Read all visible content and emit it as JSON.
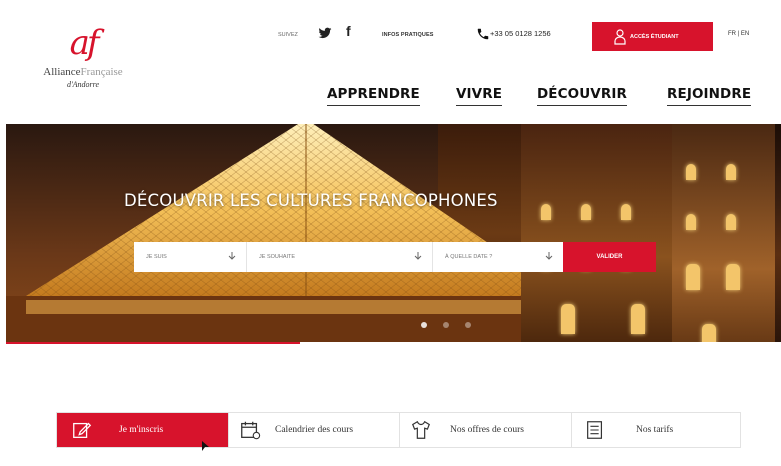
{
  "logo": {
    "mark": "af",
    "name_a": "Alliance",
    "name_b": "Française",
    "subtitle": "d'Andorre"
  },
  "topbar": {
    "follow": "SUIVEZ",
    "twitter_icon": "twitter-icon",
    "facebook_icon": "facebook-icon",
    "infos_label": "INFOS PRATIQUES",
    "phone_icon": "phone-icon",
    "phone": "+33 05 0128 1256",
    "acces_label": "ACCÈS ÉTUDIANT",
    "lang": "FR | EN"
  },
  "nav": {
    "items": [
      {
        "label": "APPRENDRE"
      },
      {
        "label": "VIVRE"
      },
      {
        "label": "DÉCOUVRIR"
      },
      {
        "label": "REJOINDRE"
      }
    ]
  },
  "hero": {
    "title": "DÉCOUVRIR LES CULTURES FRANCOPHONES",
    "search": {
      "select1": "JE SUIS",
      "select2": "JE SOUHAITE",
      "select3": "À QUELLE DATE ?",
      "submit": "VALIDER"
    },
    "slides": 3,
    "active_slide": 1
  },
  "tabs": [
    {
      "label": "Je m'inscris",
      "icon": "edit-icon",
      "active": true
    },
    {
      "label": "Calendrier des cours",
      "icon": "calendar-icon",
      "active": false
    },
    {
      "label": "Nos offres de cours",
      "icon": "tshirt-icon",
      "active": false
    },
    {
      "label": "Nos tarifs",
      "icon": "price-list-icon",
      "active": false
    }
  ],
  "colors": {
    "brand": "#d7132c"
  }
}
